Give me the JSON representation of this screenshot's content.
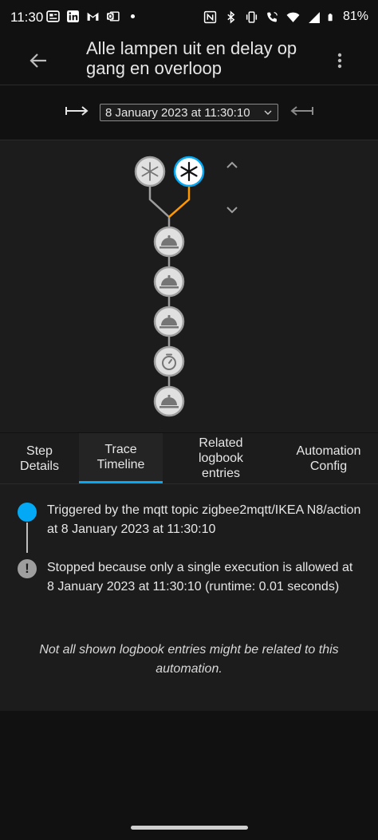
{
  "status_bar": {
    "time": "11:30",
    "battery_percent": "81%",
    "left_icons": [
      "news-icon",
      "linkedin-icon",
      "gmail-icon",
      "outlook-icon",
      "dot-icon"
    ],
    "right_icons": [
      "nfc-icon",
      "bluetooth-icon",
      "vibrate-icon",
      "wifi-call-icon",
      "wifi-icon",
      "signal-5g-icon",
      "battery-icon"
    ]
  },
  "header": {
    "title": "Alle lampen uit en delay op gang en overloop"
  },
  "trace_selector": {
    "selected_trace": "8 January 2023 at 11:30:10"
  },
  "graph": {
    "triggers": [
      {
        "icon": "snowflake-icon",
        "active": false
      },
      {
        "icon": "snowflake-icon",
        "active": true
      }
    ],
    "actions": [
      "service-icon",
      "service-icon",
      "service-icon",
      "delay-timer-icon",
      "service-icon"
    ]
  },
  "tabs": [
    {
      "label": "Step Details",
      "active": false
    },
    {
      "label": "Trace Timeline",
      "active": true
    },
    {
      "label": "Related logbook entries",
      "active": false
    },
    {
      "label": "Automation Config",
      "active": false
    }
  ],
  "timeline": {
    "entries": [
      {
        "text": "Triggered by the mqtt topic zigbee2mqtt/IKEA N8/action at 8 January 2023 at 11:30:10"
      },
      {
        "text": "Stopped because only a single execution is allowed at 8 January 2023 at 11:30:10 (runtime: 0.01 seconds)"
      }
    ],
    "note": "Not all shown logbook entries might be related to this automation.",
    "stop_glyph": "!"
  },
  "colors": {
    "accent": "#03a9f4",
    "active_path": "#ff9800",
    "inactive_path": "#9e9e9e"
  }
}
